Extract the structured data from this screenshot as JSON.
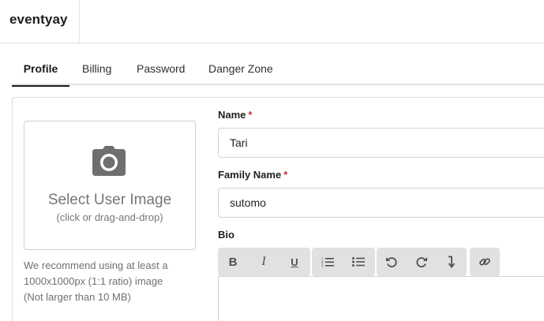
{
  "app": {
    "brand": "eventyay"
  },
  "tabs": [
    {
      "label": "Profile",
      "active": true
    },
    {
      "label": "Billing",
      "active": false
    },
    {
      "label": "Password",
      "active": false
    },
    {
      "label": "Danger Zone",
      "active": false
    }
  ],
  "image_upload": {
    "icon": "camera-icon",
    "title": "Select User Image",
    "subtitle": "(click or drag-and-drop)",
    "recommendation_lines": [
      "We recommend using at least a",
      "1000x1000px (1:1 ratio) image",
      "(Not larger than 10 MB)"
    ]
  },
  "form": {
    "name": {
      "label": "Name",
      "required_mark": "*",
      "value": "Tari"
    },
    "family_name": {
      "label": "Family Name",
      "required_mark": "*",
      "value": "sutomo"
    },
    "bio": {
      "label": "Bio",
      "value": "",
      "toolbar": [
        {
          "icon": "bold-icon",
          "glyph": "B"
        },
        {
          "icon": "italic-icon",
          "glyph": "I"
        },
        {
          "icon": "underline-icon",
          "glyph": "U"
        },
        {
          "icon": "ordered-list-icon"
        },
        {
          "icon": "unordered-list-icon"
        },
        {
          "icon": "undo-icon"
        },
        {
          "icon": "redo-icon"
        },
        {
          "icon": "line-break-icon"
        },
        {
          "icon": "link-icon"
        }
      ]
    }
  },
  "colors": {
    "required": "#d0302e",
    "toolbar_bg": "#e0e1e2",
    "active_tab_underline": "#1b1b1b"
  }
}
